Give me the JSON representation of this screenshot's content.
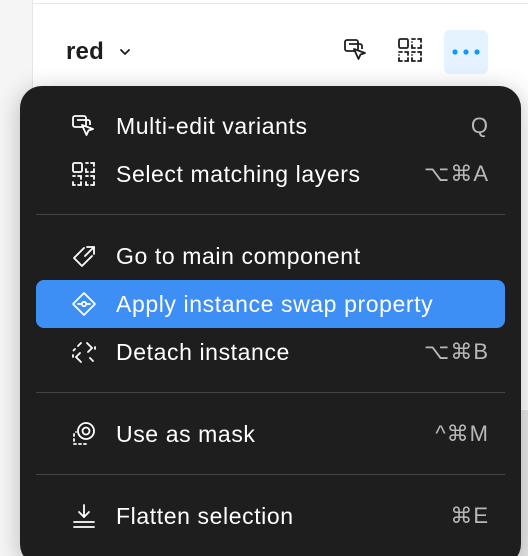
{
  "panel": {
    "instance_name": "red"
  },
  "menu": {
    "items": [
      {
        "label": "Multi-edit variants",
        "shortcut": "Q",
        "icon": "multi-edit-variants-icon"
      },
      {
        "label": "Select matching layers",
        "shortcut": "⌥⌘A",
        "icon": "select-matching-layers-icon"
      },
      {
        "label": "Go to main component",
        "shortcut": "",
        "icon": "go-to-main-component-icon"
      },
      {
        "label": "Apply instance swap property",
        "shortcut": "",
        "icon": "instance-swap-icon",
        "highlighted": true
      },
      {
        "label": "Detach instance",
        "shortcut": "⌥⌘B",
        "icon": "detach-instance-icon"
      },
      {
        "label": "Use as mask",
        "shortcut": "^⌘M",
        "icon": "mask-icon"
      },
      {
        "label": "Flatten selection",
        "shortcut": "⌘E",
        "icon": "flatten-icon"
      }
    ]
  },
  "colors": {
    "menu_bg": "#1e1e1e",
    "highlight": "#3d8ef5",
    "active_button_bg": "#e5f2ff",
    "accent": "#0d99ff"
  }
}
